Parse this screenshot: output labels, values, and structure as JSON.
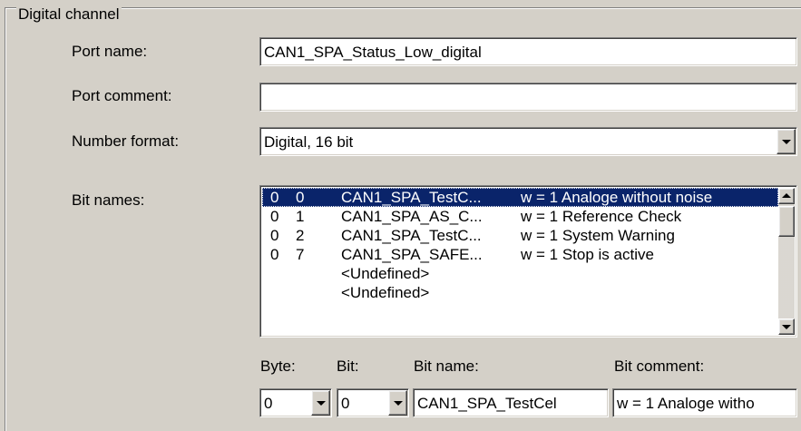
{
  "group": {
    "title": "Digital channel"
  },
  "port_name": {
    "label": "Port name:",
    "value": "CAN1_SPA_Status_Low_digital"
  },
  "port_comment": {
    "label": "Port comment:",
    "value": ""
  },
  "number_format": {
    "label": "Number format:",
    "value": "Digital, 16 bit"
  },
  "bit_names": {
    "label": "Bit names:",
    "rows": [
      {
        "byte": "0",
        "bit": "0",
        "name": "CAN1_SPA_TestC...",
        "comment": "w = 1 Analoge without noise",
        "selected": true
      },
      {
        "byte": "0",
        "bit": "1",
        "name": "CAN1_SPA_AS_C...",
        "comment": "w = 1 Reference Check",
        "selected": false
      },
      {
        "byte": "0",
        "bit": "2",
        "name": "CAN1_SPA_TestC...",
        "comment": "w = 1 System Warning",
        "selected": false
      },
      {
        "byte": "0",
        "bit": "7",
        "name": "CAN1_SPA_SAFE...",
        "comment": "w = 1 Stop is active",
        "selected": false
      },
      {
        "byte": "",
        "bit": "",
        "name": "<Undefined>",
        "comment": "",
        "selected": false
      },
      {
        "byte": "",
        "bit": "",
        "name": "<Undefined>",
        "comment": "",
        "selected": false
      }
    ]
  },
  "editor": {
    "byte_label": "Byte:",
    "bit_label": "Bit:",
    "bit_name_label": "Bit name:",
    "bit_comment_label": "Bit comment:",
    "byte_value": "0",
    "bit_value": "0",
    "bit_name_value": "CAN1_SPA_TestCel",
    "bit_comment_value": "w = 1 Analoge witho"
  },
  "icons": {
    "dropdown": "chevron-down-icon",
    "scroll_up": "scroll-up-arrow-icon",
    "scroll_down": "scroll-down-arrow-icon"
  },
  "colors": {
    "window_bg": "#d4d0c8",
    "selection_bg": "#0a246a",
    "selection_fg": "#ffffff"
  }
}
